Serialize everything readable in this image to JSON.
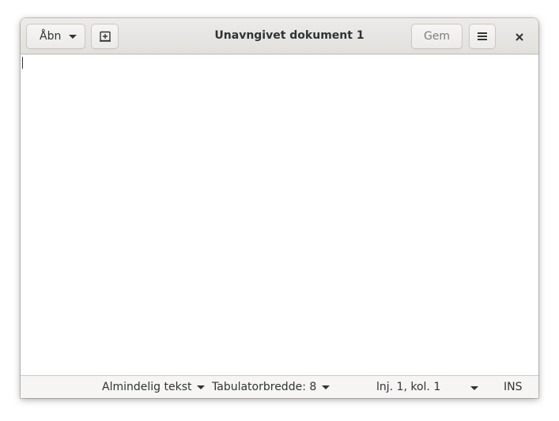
{
  "window": {
    "title": "Unavngivet dokument 1"
  },
  "headerbar": {
    "open_label": "Åbn",
    "open_icon": "chevron-down-icon",
    "new_tab_icon": "new-document-icon",
    "save_label": "Gem",
    "menu_icon": "hamburger-menu-icon",
    "close_icon": "close-icon"
  },
  "editor": {
    "content": ""
  },
  "statusbar": {
    "language": "Almindelig tekst",
    "tab_width": "Tabulatorbredde: 8",
    "position": "lnj. 1, kol. 1",
    "insert_mode": "INS"
  },
  "colors": {
    "headerbar_bg": "#e8e6e3",
    "text": "#2e3436",
    "disabled_text": "#7a7e7f"
  }
}
